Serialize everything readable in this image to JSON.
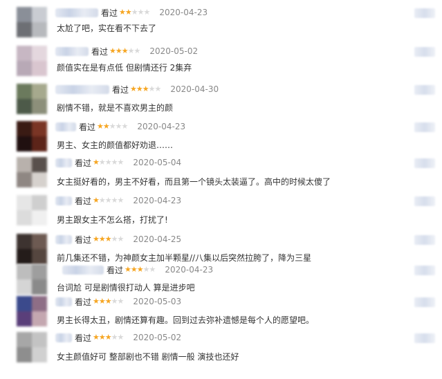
{
  "reviews": [
    {
      "action": "看过",
      "stars": 2,
      "date": "2020-04-23",
      "text": "太尬了吧，实在看不下去了",
      "avatar_colors": [
        "#8a8f98",
        "#c9ccd2",
        "#6d6f74",
        "#b7b9bd"
      ]
    },
    {
      "action": "看过",
      "stars": 3,
      "date": "2020-05-02",
      "text": "颜值实在是有点低 但剧情还行 2集弃",
      "avatar_colors": [
        "#c7b7c3",
        "#e4d7de",
        "#b8a9b6",
        "#d9c6cf"
      ]
    },
    {
      "action": "看过",
      "stars": 3,
      "date": "2020-04-30",
      "text": "剧情不错，就是不喜欢男主的颜",
      "avatar_colors": [
        "#6b7a5d",
        "#a6a98d",
        "#4d5a49",
        "#8c8f7a"
      ]
    },
    {
      "action": "看过",
      "stars": 2,
      "date": "2020-04-23",
      "text": "男主、女主的颜值都好劝退……",
      "avatar_colors": [
        "#3a1b14",
        "#7a3525",
        "#201010",
        "#5c2419"
      ]
    },
    {
      "action": "看过",
      "stars": 1,
      "date": "2020-05-04",
      "text": "女主挺好看的，男主不好看，而且第一个镜头太装逼了。高中的时候太傻了",
      "avatar_colors": [
        "#b8b1ac",
        "#59504c",
        "#8f8783",
        "#d6d1cd"
      ]
    },
    {
      "action": "看过",
      "stars": 1,
      "date": "2020-04-23",
      "text": "男主跟女主不怎么搭，打扰了!",
      "avatar_colors": [
        "#e6e6e6",
        "#cfcfcf",
        "#dcdcdc",
        "#f0f0f0"
      ]
    },
    {
      "action": "看过",
      "stars": 3,
      "date": "2020-04-25",
      "text": "前几集还不错，为神颜女主加半颗星//八集以后突然拉胯了，降为三星",
      "avatar_colors": [
        "#3d3330",
        "#6d5a52",
        "#241c1a",
        "#55463f"
      ]
    },
    {
      "action": "看过",
      "stars": 3,
      "date": "2020-04-23",
      "text": "台词尬 可是剧情很打动人 算是进步吧",
      "avatar_colors": [
        "#bdbdbd",
        "#9e9e9e",
        "#d5d5d5",
        "#8a8a8a"
      ]
    },
    {
      "action": "看过",
      "stars": 3,
      "date": "2020-05-03",
      "text": "男主长得太丑，剧情还算有趣。回到过去弥补遗憾是每个人的愿望吧。",
      "avatar_colors": [
        "#3b4a8c",
        "#8e6e86",
        "#5a3f7a",
        "#c4a7b0"
      ]
    },
    {
      "action": "看过",
      "stars": 3,
      "date": "2020-05-02",
      "text": "女主颜值好可 整部剧也不错 剧情一般 演技也还好",
      "avatar_colors": [
        "#a7a7a7",
        "#c3c3c3",
        "#8e8e8e",
        "#d0d0d0"
      ]
    }
  ]
}
